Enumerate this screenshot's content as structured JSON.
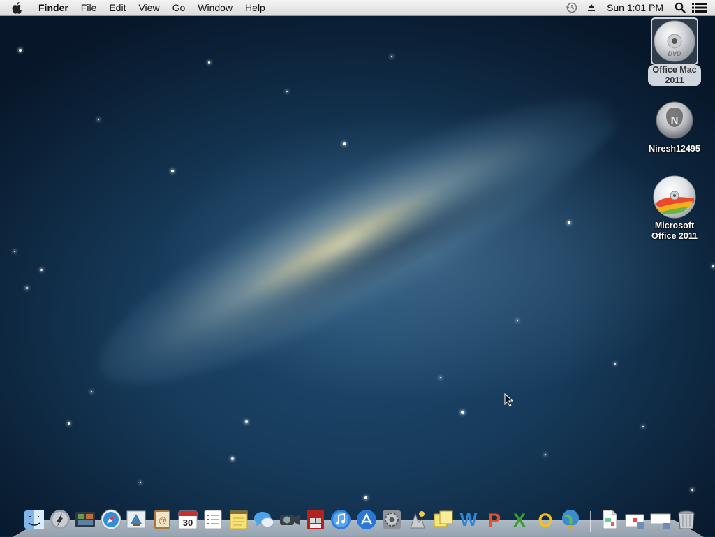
{
  "menubar": {
    "apple_menu_icon": "apple-logo-icon",
    "app_name": "Finder",
    "menus": [
      "File",
      "Edit",
      "View",
      "Go",
      "Window",
      "Help"
    ],
    "status_icons": [
      "time-machine-icon",
      "eject-icon"
    ],
    "clock": "Sun 1:01 PM",
    "right_icons": [
      "spotlight-search-icon",
      "notification-center-icon"
    ]
  },
  "desktop": {
    "items": [
      {
        "label_line1": "Office Mac",
        "label_line2": "2011",
        "icon": "dvd-disc-icon",
        "selected": true
      },
      {
        "label_line1": "Niresh12495",
        "label_line2": "",
        "icon": "install-disk-icon",
        "selected": false
      },
      {
        "label_line1": "Microsoft",
        "label_line2": "Office 2011",
        "icon": "office-installer-disc-icon",
        "selected": false
      }
    ]
  },
  "dock": {
    "apps": [
      "finder-icon",
      "launchpad-icon",
      "mission-control-icon",
      "safari-icon",
      "mail-icon",
      "contacts-icon",
      "calendar-icon",
      "reminders-icon",
      "notes-icon",
      "messages-icon",
      "facetime-icon",
      "photo-booth-icon",
      "itunes-icon",
      "app-store-icon",
      "system-preferences-icon",
      "preview-icon",
      "stickies-icon",
      "word-icon",
      "powerpoint-icon",
      "excel-icon",
      "outlook-icon",
      "network-globe-icon"
    ],
    "calendar_day": "30",
    "documents": [
      "document-icon",
      "downloads-stack-icon",
      "folder-stack-icon",
      "trash-icon"
    ]
  },
  "colors": {
    "menubar_top": "#f4f4f4",
    "menubar_bottom": "#dcdcdc",
    "wallpaper_dark": "#0c2239",
    "wallpaper_mid": "#1f4a6e",
    "galaxy_core": "#fff4c4",
    "label_text": "#ffffff"
  }
}
